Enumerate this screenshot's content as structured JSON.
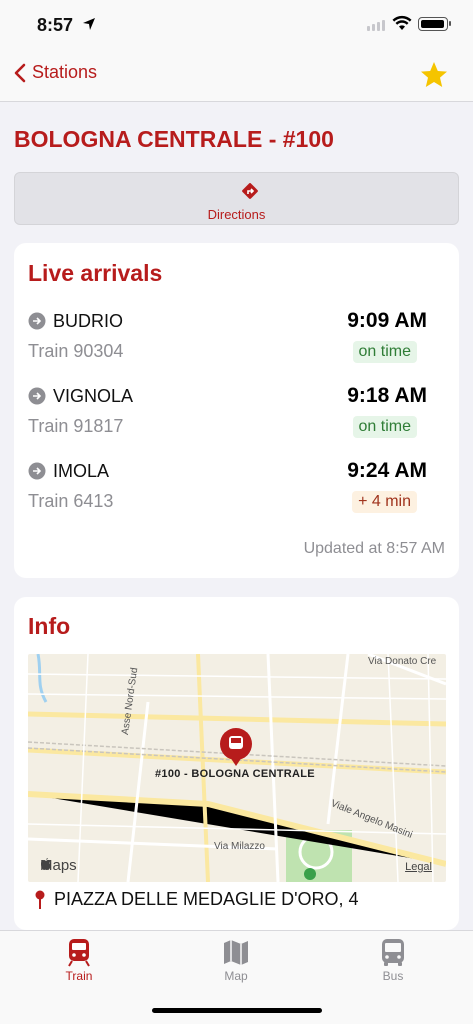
{
  "status_bar": {
    "time": "8:57"
  },
  "nav": {
    "back_label": "Stations"
  },
  "station": {
    "title": "BOLOGNA CENTRALE - #100"
  },
  "directions": {
    "label": "Directions"
  },
  "arrivals": {
    "title": "Live arrivals",
    "items": [
      {
        "destination": "BUDRIO",
        "train": "Train 90304",
        "time": "9:09 AM",
        "status": "on time",
        "status_kind": "ontime"
      },
      {
        "destination": "VIGNOLA",
        "train": "Train 91817",
        "time": "9:18 AM",
        "status": "on time",
        "status_kind": "ontime"
      },
      {
        "destination": "IMOLA",
        "train": "Train 6413",
        "time": "9:24 AM",
        "status": "+ 4 min",
        "status_kind": "late"
      }
    ],
    "updated": "Updated at 8:57 AM"
  },
  "info": {
    "title": "Info",
    "map": {
      "pin_label": "#100 - BOLOGNA CENTRALE",
      "streets": [
        "Via Donato Cre",
        "Asse Nord-Sud",
        "Viale Angelo Masini",
        "Via Milazzo"
      ],
      "brand": "Maps",
      "legal": "Legal"
    },
    "address": "PIAZZA DELLE MEDAGLIE D'ORO, 4"
  },
  "tabs": [
    {
      "label": "Train",
      "icon": "train-icon",
      "active": true
    },
    {
      "label": "Map",
      "icon": "map-icon",
      "active": false
    },
    {
      "label": "Bus",
      "icon": "bus-icon",
      "active": false
    }
  ],
  "colors": {
    "accent": "#b71c1c",
    "ontime_bg": "#e6f5e8",
    "ontime_fg": "#2f7d36",
    "late_bg": "#fdf1e1",
    "late_fg": "#a0331d"
  }
}
